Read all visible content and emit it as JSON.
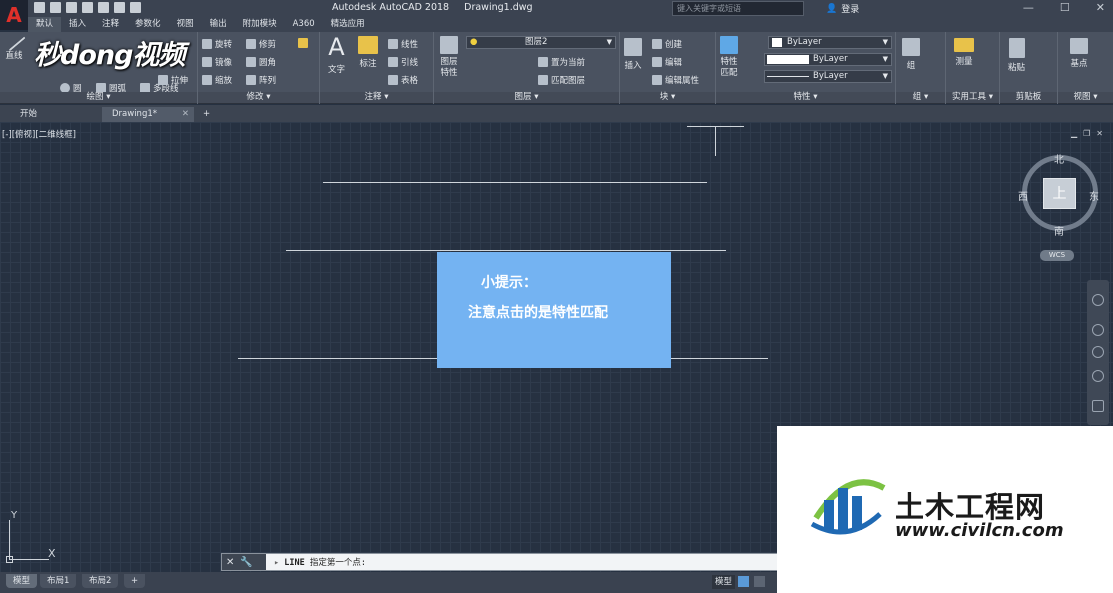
{
  "window": {
    "app_title": "Autodesk AutoCAD 2018",
    "doc_title": "Drawing1.dwg",
    "search_placeholder": "键入关键字或短语",
    "login": "登录"
  },
  "ribbon_tabs": [
    "默认",
    "插入",
    "注释",
    "参数化",
    "视图",
    "输出",
    "附加模块",
    "A360",
    "精选应用"
  ],
  "panels": {
    "draw": {
      "label": "绘图",
      "line": "直线",
      "polyline": "多段线",
      "circle": "圆",
      "arc": "圆弧"
    },
    "modify": {
      "label": "修改",
      "rotate": "旋转",
      "trim": "修剪",
      "mirror": "镜像",
      "fillet": "圆角",
      "stretch": "拉伸",
      "scale": "缩放",
      "array": "阵列"
    },
    "annotation": {
      "label": "注释",
      "text": "文字",
      "dimension": "标注",
      "linear": "线性",
      "leader": "引线",
      "table": "表格"
    },
    "layers": {
      "label": "图层",
      "layer_props": "图层\n特性",
      "current_layer": "图层2",
      "set_current": "置为当前",
      "match_layer": "匹配图层"
    },
    "block": {
      "label": "块",
      "insert": "插入",
      "create": "创建",
      "edit": "编辑",
      "edit_attr": "编辑属性"
    },
    "properties": {
      "label": "特性",
      "match": "特性\n匹配",
      "color": "ByLayer",
      "linetype": "ByLayer",
      "lineweight": "ByLayer"
    },
    "groups": {
      "label": "组",
      "group": "组"
    },
    "utilities": {
      "label": "实用工具",
      "measure": "测量"
    },
    "clipboard": {
      "label": "剪贴板",
      "paste": "粘贴"
    },
    "view": {
      "label": "视图",
      "base": "基点"
    }
  },
  "doc_tabs": {
    "start": "开始",
    "drawing": "Drawing1*"
  },
  "viewport": {
    "label": "[-][俯视][二维线框]"
  },
  "tip": {
    "title": "小提示：",
    "body": "注意点击的是特性匹配"
  },
  "viewcube": {
    "face": "上",
    "north": "北",
    "south": "南",
    "east": "东",
    "west": "西",
    "wcs": "WCS"
  },
  "ucs": {
    "x": "X",
    "y": "Y"
  },
  "command": {
    "name": "LINE",
    "prompt": "指定第一个点:"
  },
  "layout_tabs": [
    "模型",
    "布局1",
    "布局2"
  ],
  "status": {
    "model": "模型"
  },
  "watermark_top": {
    "text": "秒dong视频"
  },
  "watermark_bottom": {
    "cn": "土木工程网",
    "url": "www.civilcn.com"
  },
  "colors": {
    "canvas": "#263141",
    "tip_box": "#74b3f2",
    "ribbon": "#4a5260"
  }
}
